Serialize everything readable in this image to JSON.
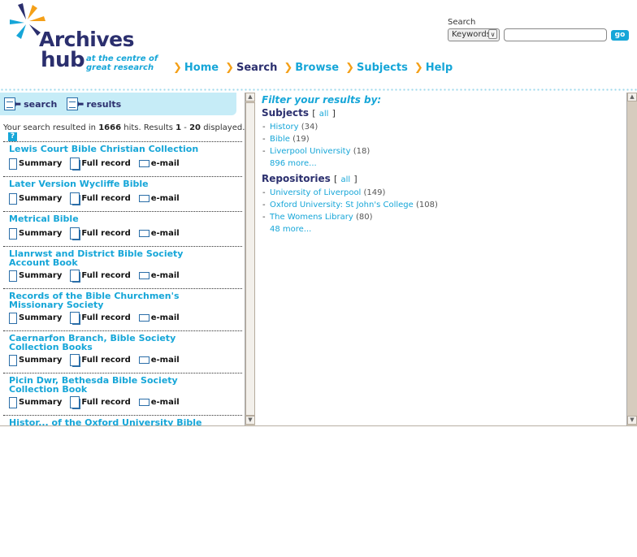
{
  "logo": {
    "word1": "Archives",
    "word2": "hub",
    "tagline_line1": "at the centre of",
    "tagline_line2": "great research"
  },
  "nav": [
    {
      "label": "Home",
      "active": false
    },
    {
      "label": "Search",
      "active": true
    },
    {
      "label": "Browse",
      "active": false
    },
    {
      "label": "Subjects",
      "active": false
    },
    {
      "label": "Help",
      "active": false
    }
  ],
  "search": {
    "title": "Search",
    "type_selected": "Keywords",
    "query": "",
    "go_label": "go"
  },
  "toolbar": {
    "search_label": "search",
    "results_label": "results"
  },
  "summary": {
    "prefix": "Your search resulted in",
    "hits": "1666",
    "hits_suffix": "hits. Results",
    "from": "1",
    "dash": "-",
    "to": "20",
    "suffix": "displayed.",
    "help": "?"
  },
  "result_actions": {
    "summary": "Summary",
    "full": "Full record",
    "email": "e-mail"
  },
  "results": [
    {
      "title": "Lewis Court Bible Christian Collection"
    },
    {
      "title": "Later Version Wycliffe Bible"
    },
    {
      "title": "Metrical Bible"
    },
    {
      "title": "Llanrwst and District Bible Society Account Book"
    },
    {
      "title": "Records of the Bible Churchmen's Missionary Society"
    },
    {
      "title": "Caernarfon Branch, Bible Society Collection Books"
    },
    {
      "title": "Picin Dwr, Bethesda Bible Society Collection Book"
    },
    {
      "title": "Histor... of the Oxford University Bible Uni..."
    }
  ],
  "filter": {
    "title": "Filter your results by:",
    "subjects": {
      "heading": "Subjects",
      "open_bracket": "[",
      "all": "all",
      "close_bracket": "]",
      "items": [
        {
          "name": "History",
          "count": "(34)"
        },
        {
          "name": "Bible",
          "count": "(19)"
        },
        {
          "name": "Liverpool University",
          "count": "(18)"
        }
      ],
      "more": "896 more..."
    },
    "repositories": {
      "heading": "Repositories",
      "open_bracket": "[",
      "all": "all",
      "close_bracket": "]",
      "items": [
        {
          "name": "University of Liverpool",
          "count": "(149)"
        },
        {
          "name": "Oxford University: St John's College",
          "count": "(108)"
        },
        {
          "name": "The Womens Library",
          "count": "(80)"
        }
      ],
      "more": "48 more..."
    }
  }
}
